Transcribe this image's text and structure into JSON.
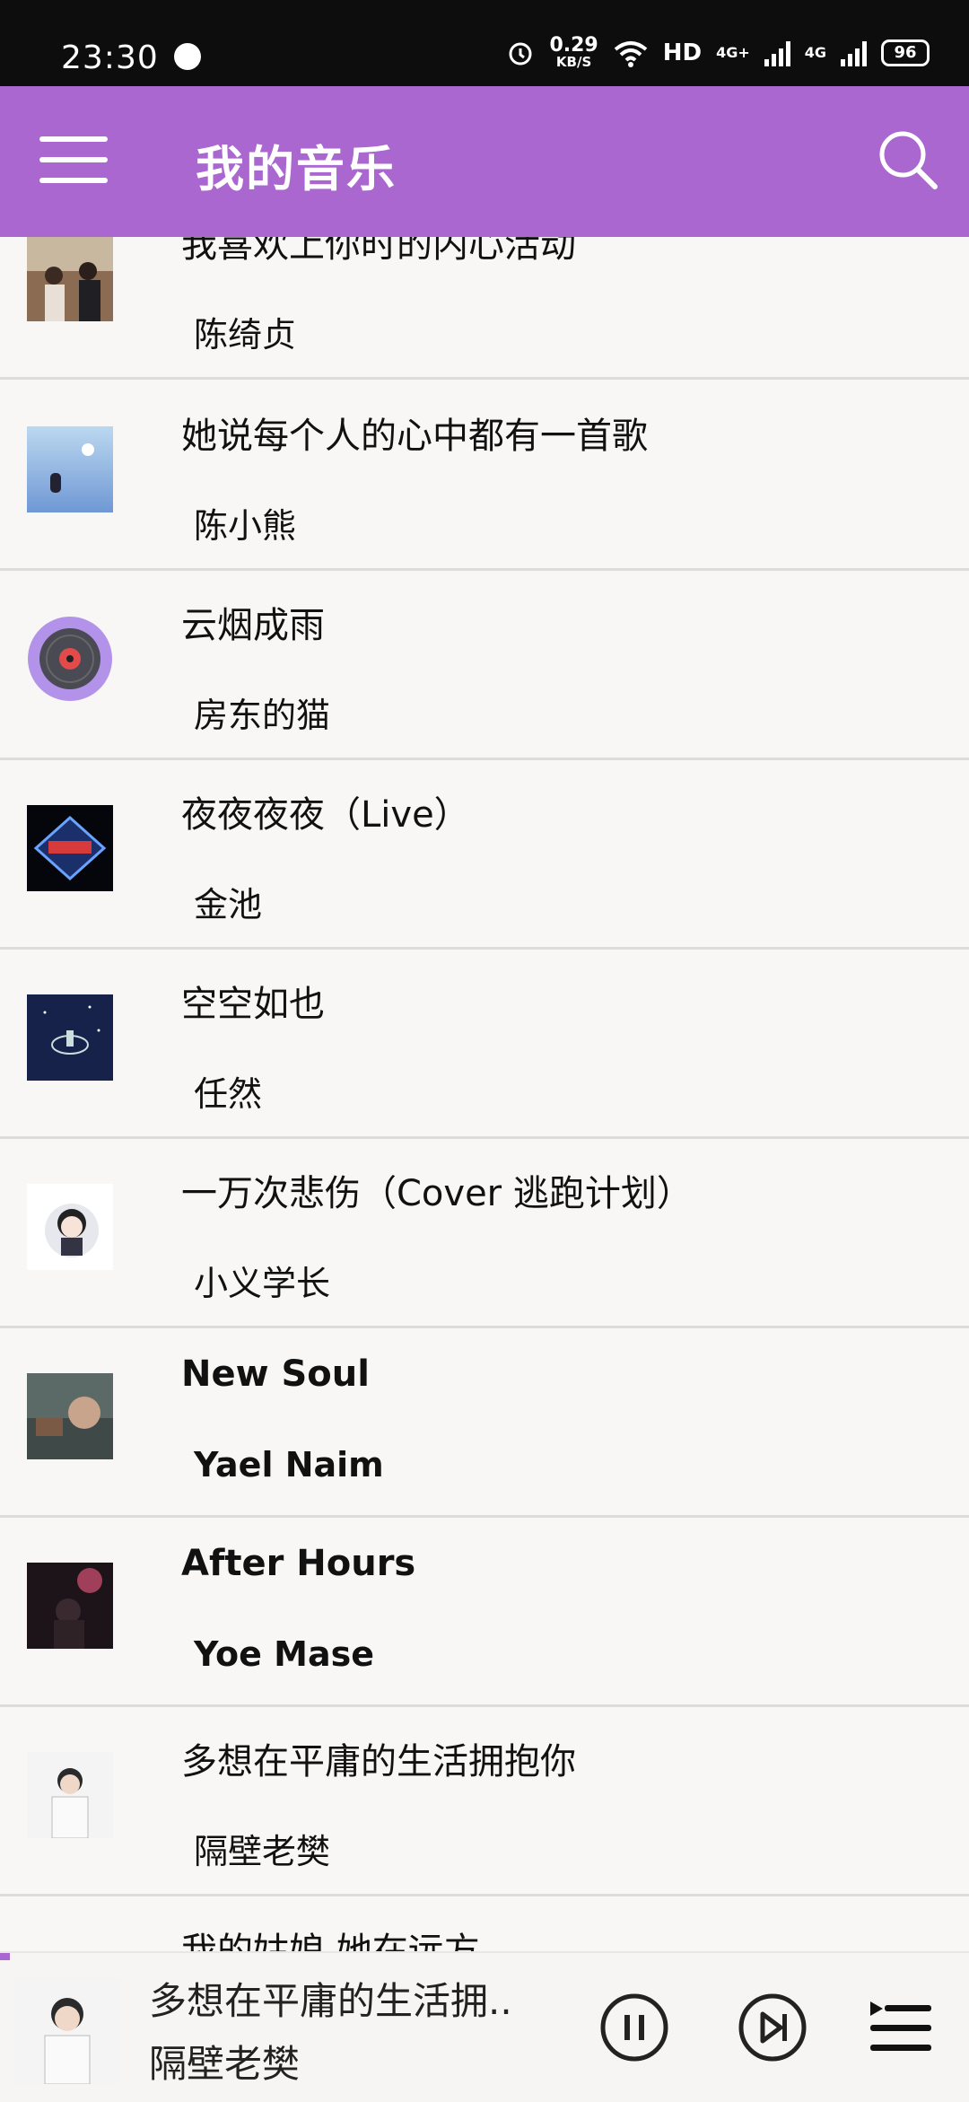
{
  "status_bar": {
    "time": "23:30",
    "speed_value": "0.29",
    "speed_unit": "KB/S",
    "network": "HD",
    "signal1": "4G+",
    "signal2": "4G",
    "battery": "96"
  },
  "header": {
    "title": "我的音乐",
    "accent_color": "#a967cf"
  },
  "songs": [
    {
      "title": "我喜欢上你时的内心活动",
      "artist": "陈绮贞"
    },
    {
      "title": "她说每个人的心中都有一首歌",
      "artist": "陈小熊"
    },
    {
      "title": "云烟成雨",
      "artist": "房东的猫"
    },
    {
      "title": "夜夜夜夜（Live）",
      "artist": "金池"
    },
    {
      "title": "空空如也",
      "artist": "任然"
    },
    {
      "title": "一万次悲伤（Cover 逃跑计划）",
      "artist": "小义学长"
    },
    {
      "title": "New Soul",
      "artist": "Yael Naim"
    },
    {
      "title": "After Hours",
      "artist": "Yoe Mase"
    },
    {
      "title": "多想在平庸的生活拥抱你",
      "artist": "隔壁老樊"
    },
    {
      "title": "我的姑娘 她在远方",
      "artist": ""
    }
  ],
  "now_playing": {
    "title": "多想在平庸的生活拥..",
    "artist": "隔壁老樊",
    "progress": 0.01
  }
}
